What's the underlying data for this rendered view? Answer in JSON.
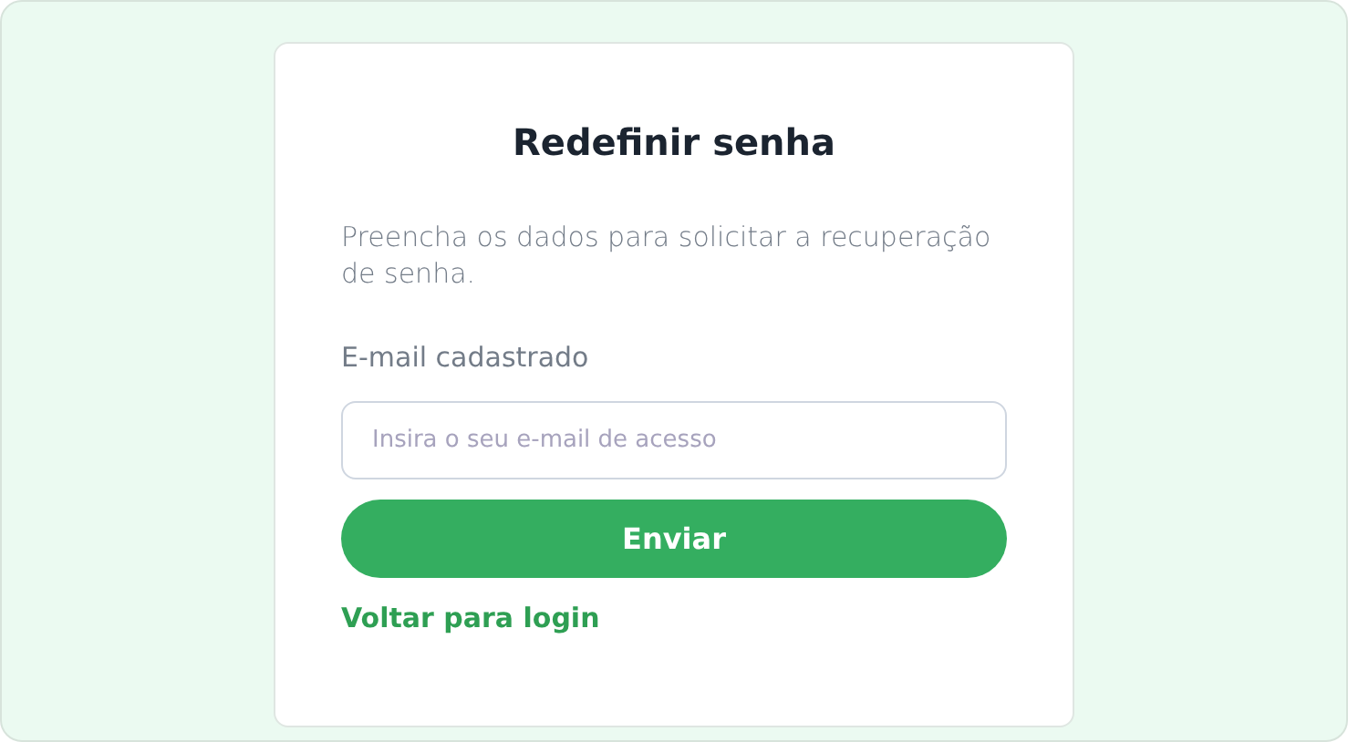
{
  "card": {
    "title": "Redefinir senha",
    "description": "Preencha os dados para solicitar a recuperação de senha.",
    "field": {
      "label": "E-mail cadastrado",
      "placeholder": "Insira o seu e-mail de acesso"
    },
    "submit": "Enviar",
    "back_link": "Voltar para login"
  }
}
